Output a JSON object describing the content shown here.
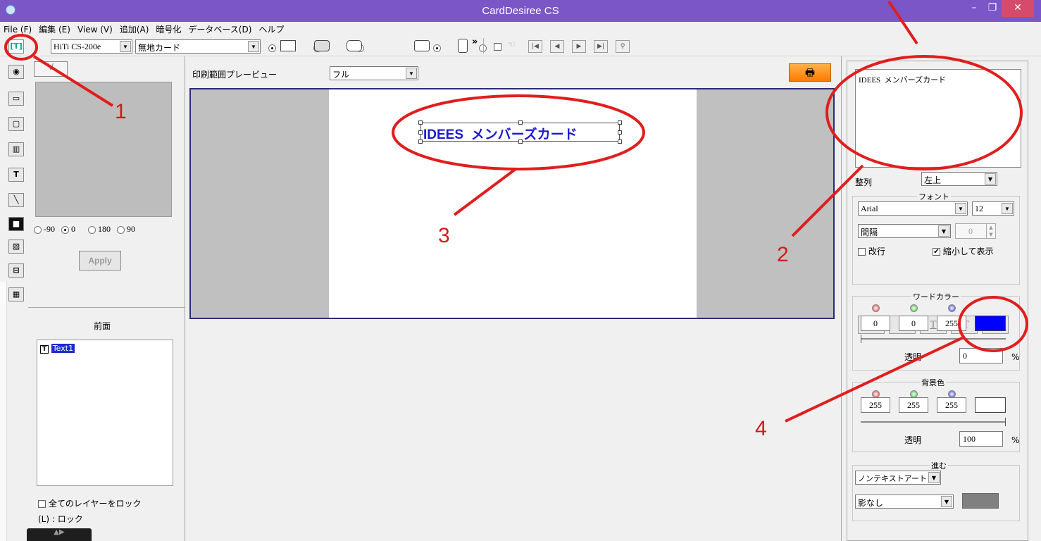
{
  "window": {
    "title": "CardDesiree CS"
  },
  "menu": [
    "File (F)",
    "編集 (E)",
    "View (V)",
    "追加(A)",
    "暗号化",
    "データベース(D)",
    "ヘルプ"
  ],
  "toolbar": {
    "printer": "HiTi CS-200e",
    "card_type": "無地カード"
  },
  "left_panel": {
    "rotations": [
      "-90",
      "0",
      "180",
      "90"
    ],
    "selected_rotation": "0",
    "apply_label": "Apply",
    "layer_title": "前面",
    "layer_item": "Text1",
    "lock_all": "全てのレイヤーをロック",
    "lock_key": "(L) : ロック"
  },
  "preview": {
    "label": "印刷範囲プレービュー",
    "mode": "フル",
    "card_text": "IDEES  メンバーズカード",
    "card_text_color": "#0000ff"
  },
  "right_panel": {
    "text_content": "IDEES  メンバーズカード",
    "align_label": "整列",
    "align_value": "左上",
    "font_group": "フォント",
    "font_name": "Arial",
    "font_size": "12",
    "spacing_label": "間隔",
    "spacing_value": "0",
    "wrap_label": "改行",
    "shrink_label": "縮小して表示",
    "word_color_group": "ワードカラー",
    "word_rgb": [
      "0",
      "0",
      "255"
    ],
    "word_swatch": "#0000ff",
    "transparency_label": "透明",
    "word_transparency": "0",
    "percent": "%",
    "bg_color_group": "背景色",
    "bg_rgb": [
      "255",
      "255",
      "255"
    ],
    "bg_swatch": "#ffffff",
    "bg_transparency": "100",
    "advance_group": "進む",
    "non_text_art": "ノンテキストアート",
    "shadow": "影なし",
    "shadow_swatch": "#808080"
  },
  "annotations": [
    "1",
    "2",
    "3",
    "4"
  ]
}
